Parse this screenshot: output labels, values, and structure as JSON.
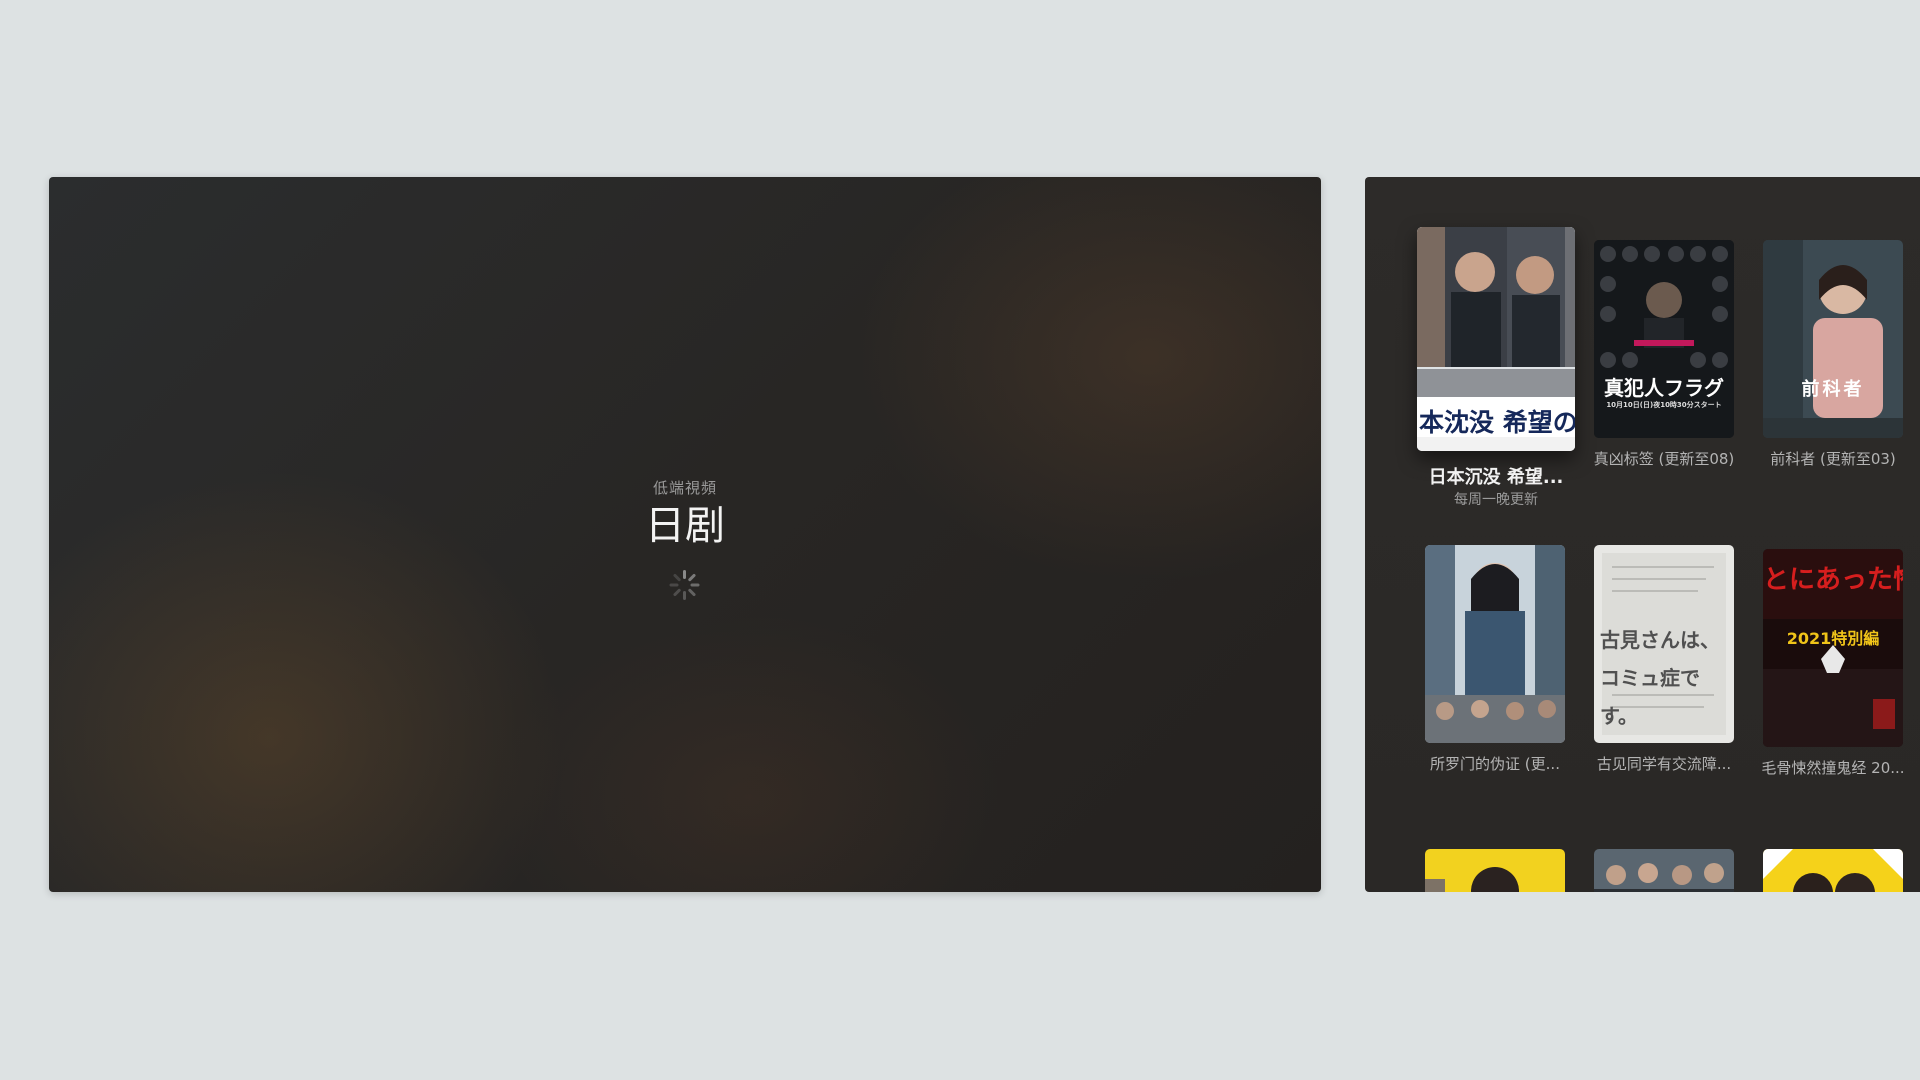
{
  "main_panel": {
    "subtitle": "低端視頻",
    "title": "日剧"
  },
  "grid": {
    "items": [
      {
        "label": "日本沉没 希望...",
        "sub": "每周一晚更新",
        "poster_text": "本沈没 希望の"
      },
      {
        "label": "真凶标签 (更新至08)",
        "poster_text": "真犯人フラグ",
        "poster_small": "10月10日(日)夜10時30分スタート"
      },
      {
        "label": "前科者 (更新至03)",
        "poster_text": "前科者"
      },
      {
        "label": "所罗门的伪证 (更..."
      },
      {
        "label": "古见同学有交流障...",
        "poster_text": "古見さんは、コミュ症です。"
      },
      {
        "label": "毛骨悚然撞鬼经 20...",
        "poster_text": "とにあった怖い",
        "poster_small": "2021特別編"
      }
    ]
  },
  "colors": {
    "background": "#dde2e3",
    "panel": "#292726",
    "title_text": "#f3f3f3",
    "caption_text": "#b4b4b4"
  }
}
